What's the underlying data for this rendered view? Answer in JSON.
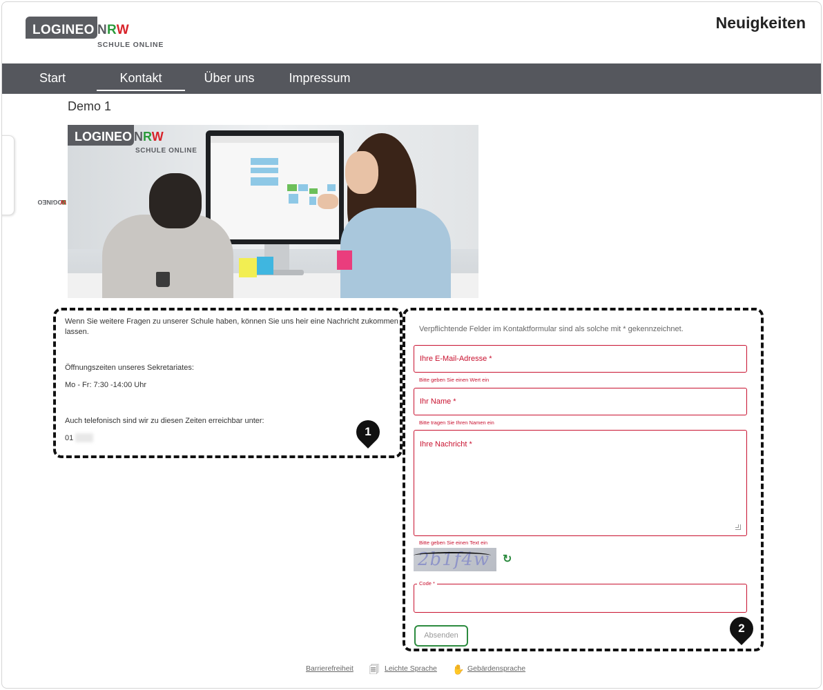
{
  "header": {
    "logo_main": "LOGINEO",
    "logo_n": "N",
    "logo_r": "R",
    "logo_w": "W",
    "logo_sub": "SCHULE ONLINE",
    "page_heading": "Neuigkeiten"
  },
  "nav": {
    "items": [
      {
        "label": "Start",
        "active": false
      },
      {
        "label": "Kontakt",
        "active": true
      },
      {
        "label": "Über uns",
        "active": false
      },
      {
        "label": "Impressum",
        "active": false
      }
    ]
  },
  "side_tab": {
    "label_a": "LOGINEO",
    "label_n": "N",
    "label_r": "R",
    "label_w": "W"
  },
  "site_title": "Demo 1",
  "hero": {
    "logo_main": "LOGINEO",
    "logo_n": "N",
    "logo_r": "R",
    "logo_w": "W",
    "logo_sub": "SCHULE ONLINE"
  },
  "info": {
    "intro": "Wenn Sie weitere Fragen zu unserer Schule haben, können Sie uns heir eine Nachricht zukommen lassen.",
    "hours_title": "Öffnungszeiten unseres Sekretariates:",
    "hours": "Mo - Fr:  7:30 -14:00 Uhr",
    "phone_intro": "Auch telefonisch sind wir zu diesen Zeiten erreichbar unter:",
    "phone": "01"
  },
  "markers": {
    "one": "1",
    "two": "2"
  },
  "form": {
    "note": "Verpflichtende Felder im Kontaktformular sind als solche mit * gekennzeichnet.",
    "email_label": "Ihre E-Mail-Adresse *",
    "email_error": "Bitte geben Sie einen Wert ein",
    "name_label": "Ihr Name *",
    "name_error": "Bitte tragen Sie Ihren Namen ein",
    "message_label": "Ihre Nachricht *",
    "message_error": "Bitte geben Sie einen Text ein",
    "captcha_text": "2b1f4w",
    "code_label": "Code *",
    "submit_label": "Absenden"
  },
  "footer": {
    "accessibility": "Barrierefreiheit",
    "easy_language": "Leichte Sprache",
    "sign_language": "Gebärdensprache"
  },
  "colors": {
    "nav_bg": "#55575d",
    "error_red": "#c8102e",
    "accent_green": "#2b8a3e"
  },
  "icons": {
    "refresh": "refresh-icon",
    "easy_language": "easy-language-icon",
    "sign_language": "sign-language-icon"
  }
}
